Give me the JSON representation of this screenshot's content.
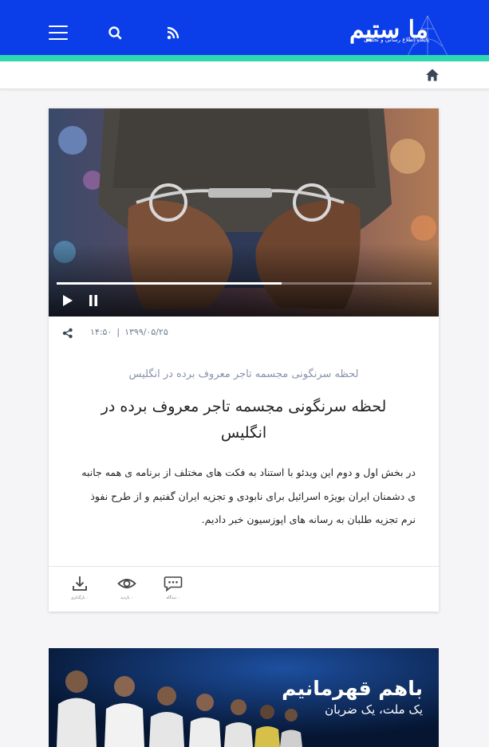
{
  "header": {
    "logo_text": "ما ستیم",
    "logo_tagline": "پایگاه اطلاع رسانی و تحلیلی",
    "colors": {
      "primary": "#0b3ee8",
      "accent": "#2ed8b0"
    },
    "icons": [
      "menu-icon",
      "search-icon",
      "rss-icon"
    ]
  },
  "breadcrumb": {
    "icon": "home-icon"
  },
  "article": {
    "video": {
      "progress_percent": 60,
      "state": "paused",
      "controls": [
        "play-icon",
        "pause-icon"
      ]
    },
    "date": "۱۳۹۹/۰۵/۲۵",
    "separator": "|",
    "time": "۱۴:۵۰",
    "surtitle": "لحظه سرنگونی مجسمه تاجر معروف برده در انگلیس",
    "title": "لحظه سرنگونی مجسمه تاجر معروف برده در انگلیس",
    "lead": "در بخش اول و دوم این ویدئو با استناد به فکت های مختلف از برنامه ی همه جانبه ی دشمنان ایران بویژه اسرائیل برای نابودی و تجزیه ایران گفتیم و از طرح نفوذ نرم تجزیه طلبان به رسانه های اپوزسیون خبر دادیم.",
    "actions": {
      "download_label": "۰ بارگذاری",
      "views_label": "۰ بازدید",
      "comments_label": "۰ دیدگاه"
    }
  },
  "banner": {
    "title": "باهم قهرمانیم",
    "subtitle": "یک ملت، یک ضربان"
  }
}
